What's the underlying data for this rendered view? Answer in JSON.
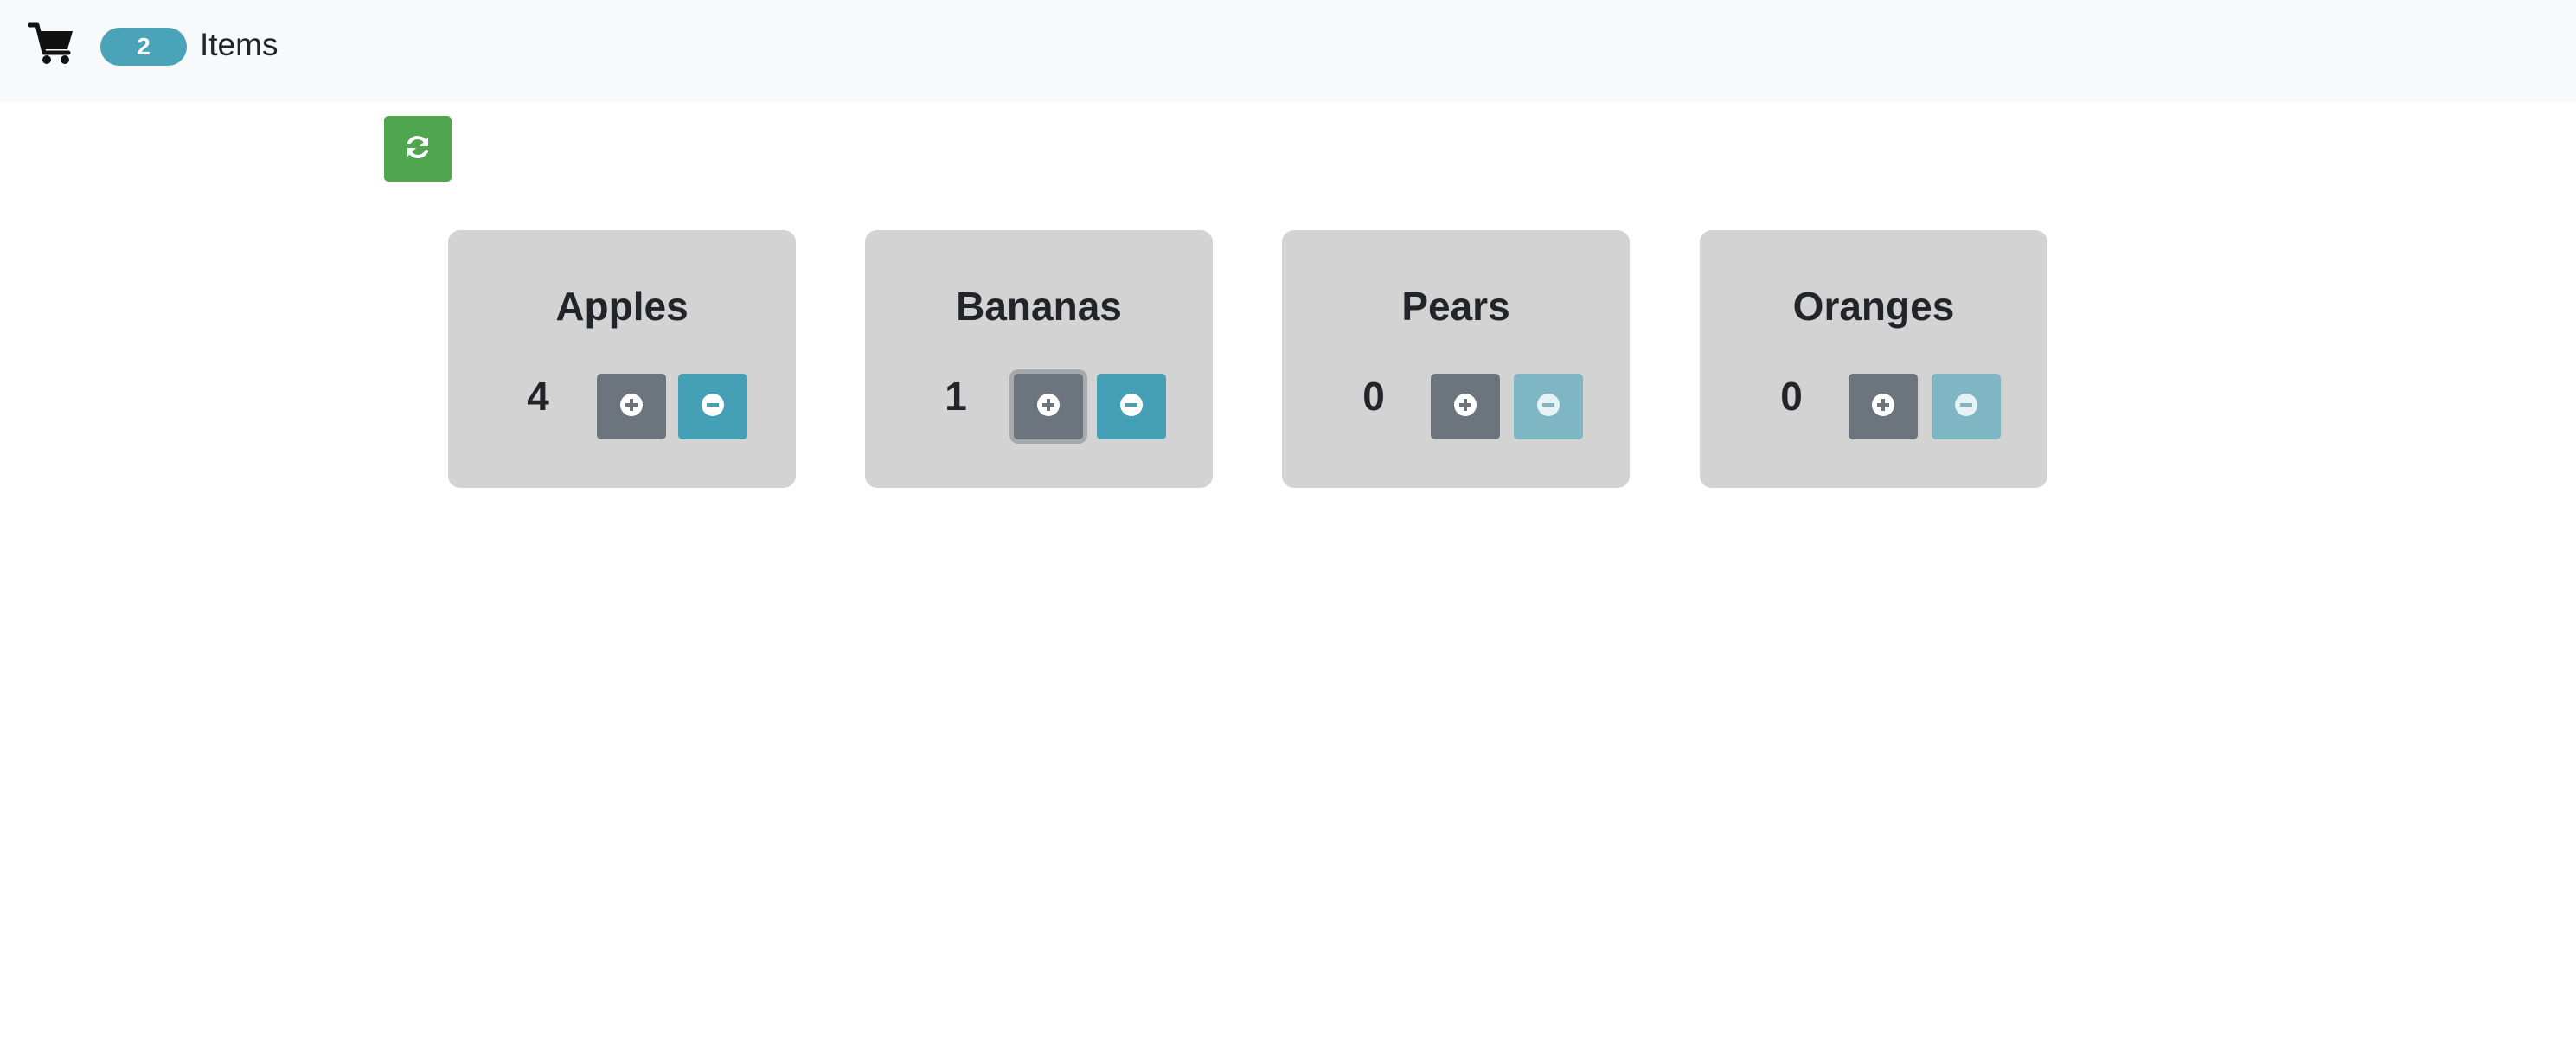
{
  "navbar": {
    "cart_icon": "shopping-cart-icon",
    "badge_count": "2",
    "items_label": "Items"
  },
  "toolbar": {
    "refresh_icon": "refresh-icon",
    "refresh_color": "#4fa64f"
  },
  "colors": {
    "badge": "#4aa3b8",
    "card_bg": "#d3d3d3",
    "plus_button": "#6c757d",
    "minus_button": "#45a0b5",
    "minus_button_disabled": "#7fb6c3"
  },
  "products": [
    {
      "name": "Apples",
      "count": "4",
      "plus_icon": "plus-circle-icon",
      "minus_icon": "minus-circle-icon",
      "minus_disabled": false
    },
    {
      "name": "Bananas",
      "count": "1",
      "plus_icon": "plus-circle-icon",
      "minus_icon": "minus-circle-icon",
      "minus_disabled": false
    },
    {
      "name": "Pears",
      "count": "0",
      "plus_icon": "plus-circle-icon",
      "minus_icon": "minus-circle-icon",
      "minus_disabled": true
    },
    {
      "name": "Oranges",
      "count": "0",
      "plus_icon": "plus-circle-icon",
      "minus_icon": "minus-circle-icon",
      "minus_disabled": true
    }
  ]
}
